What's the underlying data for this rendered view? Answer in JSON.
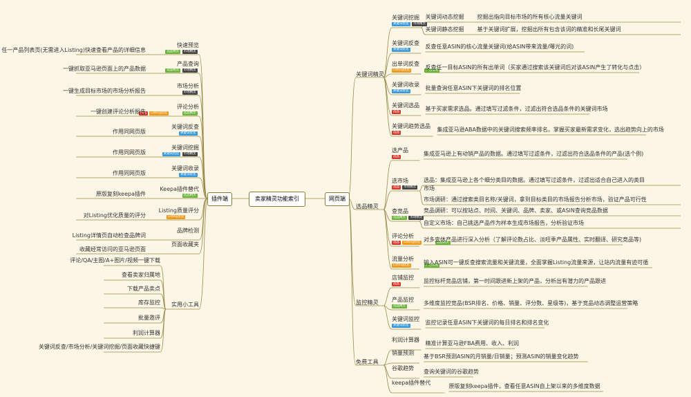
{
  "root": "卖家精灵功能索引",
  "left_hub": "插件端",
  "right_hub": "网页端",
  "colors": {
    "blue": "#3a9ad9",
    "dark": "#444444",
    "green": "#6bb33a",
    "orange": "#f09a1a",
    "red": "#d33a2a",
    "teal": "#31b3b3"
  },
  "left": [
    {
      "name": "快速预览",
      "tags": [
        [
          "选品精灵",
          "green"
        ],
        [
          "市场精灵",
          "dark"
        ]
      ],
      "desc": "任一产品列表页(无需进入Listing)快速查看产品的详细信息"
    },
    {
      "name": "产品查询",
      "tags": [
        [
          "选品精灵",
          "green"
        ],
        [
          "市场精灵",
          "dark"
        ]
      ],
      "desc": "一键抓取亚马逊页面上的产品数据"
    },
    {
      "name": "市场分析",
      "tags": [
        [
          "市场精灵",
          "dark"
        ]
      ],
      "desc": "一键生成目标市场的市场分析报告"
    },
    {
      "name": "评论分析",
      "tags": [
        [
          "选品",
          "red"
        ],
        [
          "Listing优化",
          "orange"
        ],
        [
          "选品精灵",
          "green"
        ]
      ],
      "desc": "一键创建评论分析报告"
    },
    {
      "name": "关键词反查",
      "tags": [
        [
          "关键词优化",
          "blue"
        ]
      ],
      "desc": "作用同网页版"
    },
    {
      "name": "关键词挖掘",
      "tags": [
        [
          "关键词优化",
          "blue"
        ],
        [
          "市场精灵",
          "dark"
        ]
      ],
      "desc": "作用同网页版"
    },
    {
      "name": "关键词收录",
      "tags": [
        [
          "关键词优化",
          "blue"
        ]
      ],
      "desc": "作用同网页版"
    },
    {
      "name": "Keepa插件替代",
      "tags": [
        [
          "选品精灵",
          "green"
        ]
      ],
      "desc": "原版复刻keepa插件"
    },
    {
      "name": "Listing质量评分",
      "tags": [
        [
          "Listing优化",
          "orange"
        ]
      ],
      "desc": "对Listing优化质量的评分"
    },
    {
      "name": "品牌检测",
      "tags": [],
      "desc": "Listing详情页自动检查品牌词"
    },
    {
      "name": "页面收藏夹",
      "tags": [],
      "desc": "收藏经常访问的亚马逊页面"
    }
  ],
  "tools_group": {
    "name": "实用小工具",
    "items": [
      "评论/QA/主图/A+图片/视频一键下载",
      "查看卖家归属地",
      "下载产品卖点",
      "库存监控",
      "批量邀评",
      "利润计算器",
      "关键词反查/市场分析/关键词挖掘/页面收藏快捷键"
    ]
  },
  "right": [
    {
      "section": "关键词精灵",
      "items": [
        {
          "name": "关键词挖掘",
          "tags": [
            [
              "关键词优化",
              "blue"
            ],
            [
              "市场精灵",
              "dark"
            ]
          ],
          "subs": [
            [
              "关键词动态挖掘",
              "挖掘出指向目标市场的所有核心流量关键词"
            ],
            [
              "关键词静态挖掘",
              "基于关键词扩展，挖掘出所有包含该词的精准和长尾关键词"
            ]
          ]
        },
        {
          "name": "关键词反查",
          "tags": [
            [
              "关键词优化",
              "blue"
            ]
          ],
          "desc": "反查任意ASIN的核心流量关键词(给ASIN带来流量/曝光的词)"
        },
        {
          "name": "出单词反查",
          "tags": [
            [
              "Listing优化",
              "orange"
            ],
            [
              "广告优化",
              "green"
            ]
          ],
          "desc": "反查任一目标ASIN的所有出单词（买家通过搜索该关键词后对该ASIN产生了转化与点击）"
        },
        {
          "name": "关键词收录",
          "tags": [
            [
              "关键词优化",
              "blue"
            ]
          ],
          "desc": "批量查询任意ASIN下关键词的排名位置"
        },
        {
          "name": "关键词选品",
          "tags": [
            [
              "选品",
              "red"
            ]
          ],
          "desc": "基于买家需求选品。通过填写过滤条件，过滤出符合选品条件的关键词市场"
        },
        {
          "name": "关键词趋势选品",
          "tags": [
            [
              "选品",
              "red"
            ]
          ],
          "desc": "集成亚马逊ABA数据中的关键词搜索频率排名。掌握买家最新需求变化，选出趋势向上的市场"
        }
      ]
    },
    {
      "section": "选品精灵",
      "items": [
        {
          "name": "选产品",
          "tags": [
            [
              "选品",
              "red"
            ]
          ],
          "desc": "集成亚马逊上有动销产品的数据。通过填写过滤条件，过滤出符合选品条件的产品(选个例)"
        },
        {
          "name": "选市场",
          "tags": [
            [
              "选品",
              "red"
            ],
            [
              "市场精灵",
              "dark"
            ]
          ],
          "subs": [
            [
              "",
              "选品：集成亚马逊上各个细分类目的数据。通过填写过滤条件，过滤出适合自己进入的类目",
              "市场"
            ],
            [
              "",
              "市场调研：通过搜索类目名称/关键词，拿到目标类目的市场报告分析市场，验证产品可行性"
            ]
          ]
        },
        {
          "name": "查竞品",
          "tags": [
            [
              "选品精灵",
              "green"
            ],
            [
              "市场精灵",
              "dark"
            ]
          ],
          "subs": [
            [
              "",
              "竞品调研：可以按站点、时间、关键词、品牌、卖家、或ASIN查询竞品数据"
            ],
            [
              "",
              "自定义市场：自己挑选产品作为样本生成市场报告，分析验证市场"
            ]
          ]
        },
        {
          "name": "评论分析",
          "tags": [
            [
              "选品",
              "red"
            ],
            [
              "Listing优化",
              "orange"
            ],
            [
              "选品精灵",
              "green"
            ]
          ],
          "desc": "对多变体产品进行深入分析（了解评论数占比、淡旺季产品属性、实时翻译、研究竞品等)"
        },
        {
          "name": "流量分析",
          "tags": [
            [
              "Listing优化",
              "orange"
            ],
            [
              "广告优化",
              "green"
            ]
          ],
          "desc": "输入ASIN可一键反查搜索流量和关键流量，全面掌握Listing流量来源，让站内流量有迹可循"
        }
      ]
    },
    {
      "section": "监控精灵",
      "items": [
        {
          "name": "店铺监控",
          "tags": [
            [
              "选品",
              "red"
            ]
          ],
          "desc": "监控标杆竞品店铺，第一时间跟进新上架的产品，分析出有潜力的产品跟进"
        },
        {
          "name": "产品监控",
          "tags": [
            [
              "选品精灵",
              "green"
            ]
          ],
          "desc": "多维度监控竞品(BSR排名、价格、销量、评分数、星级等)，基于竞品动态调整运营策略"
        },
        {
          "name": "关键词监控",
          "tags": [
            [
              "关键词优化",
              "blue"
            ]
          ],
          "desc": "监控记录任意ASIN下关键词的每日排名和排名变化"
        }
      ]
    },
    {
      "section": "免费工具",
      "items": [
        {
          "name": "利润计算器",
          "tags": [],
          "desc": "精准计算亚马逊FBA费用、收入、利润"
        },
        {
          "name": "销量预测",
          "tags": [],
          "desc": "基于BSR预测ASIN的月销量/日销量；预测ASIN的销量变化趋势"
        },
        {
          "name": "谷歌趋势",
          "tags": [],
          "desc": "查询关键词的谷歌趋势"
        },
        {
          "name": "keepa插件替代",
          "tags": [],
          "desc": "原版复刻keepa插件，查看任意ASIN自上架以来的多维度数据"
        }
      ]
    }
  ]
}
